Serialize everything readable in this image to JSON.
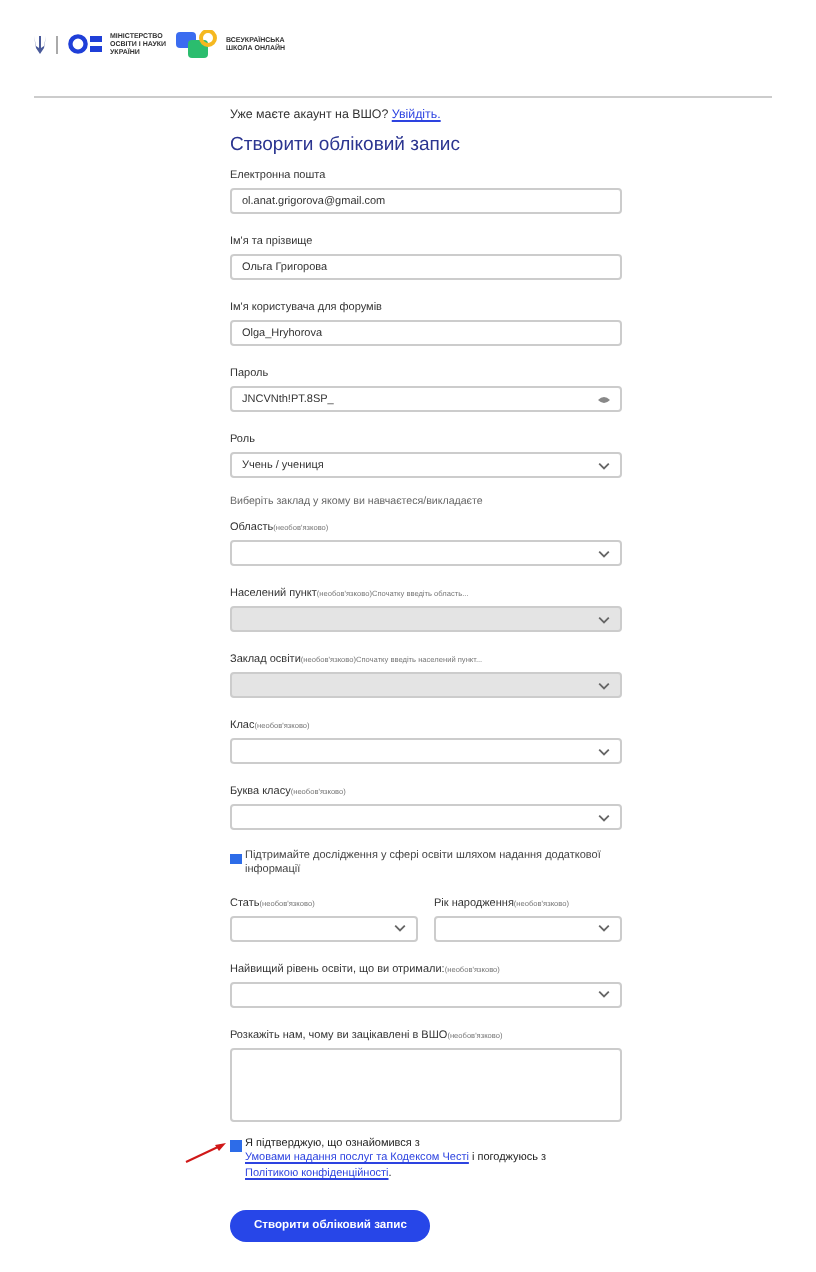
{
  "header": {
    "ministry": "МІНІСТЕРСТВО ОСВІТИ І НАУКИ УКРАЇНИ",
    "school": "ВСЕУКРАЇНСЬКА ШКОЛА ОНЛАЙН"
  },
  "login_prompt": {
    "text": "Уже маєте акаунт на ВШО?",
    "link": "Увійдіть."
  },
  "title": "Створити обліковий запис",
  "fields": [
    {
      "kind": "text",
      "label": "Електронна пошта",
      "value": "ol.anat.grigorova@gmail.com"
    },
    {
      "kind": "text",
      "label": "Ім'я та прізвище",
      "value": "Ольга Григорова"
    },
    {
      "kind": "text",
      "label": "Ім'я користувача для форумів",
      "value": "Olga_Hryhorova"
    },
    {
      "kind": "password",
      "label": "Пароль",
      "value": "JNCVNth!PT.8SP_"
    },
    {
      "kind": "select",
      "label": "Роль",
      "value": "Учень / учениця",
      "disabled": false
    },
    {
      "kind": "note",
      "text": "Виберіть заклад у якому ви навчаєтеся/викладаєте"
    },
    {
      "kind": "select",
      "label": "Область",
      "optional": "(необов'язково)",
      "disabled": false
    },
    {
      "kind": "select",
      "label": "Населений пункт",
      "optional": "(необов'язково)",
      "note": "Спочатку введіть область...",
      "disabled": true
    },
    {
      "kind": "select",
      "label": "Заклад освіти",
      "optional": "(необов'язково)",
      "note": "Спочатку введіть населений пункт...",
      "disabled": true
    },
    {
      "kind": "select",
      "label": "Клас",
      "optional": "(необов'язково)",
      "disabled": false
    },
    {
      "kind": "select",
      "label": "Буква класу",
      "optional": "(необов'язково)",
      "disabled": false
    },
    {
      "kind": "checkbox",
      "text": "Підтримайте дослідження у сфері освіти шляхом надання додаткової інформації",
      "checked": true
    },
    {
      "kind": "pair",
      "children": [
        {
          "kind": "select",
          "label": "Стать",
          "optional": "(необов'язково)",
          "disabled": false
        },
        {
          "kind": "select",
          "label": "Рік народження",
          "optional": "(необов'язково)",
          "disabled": false
        }
      ]
    },
    {
      "kind": "select",
      "label": "Найвищий рівень освіти, що ви отримали:",
      "optional": "(необов'язково)",
      "disabled": false
    },
    {
      "kind": "textarea",
      "label": "Розкажіть нам, чому ви зацікавлені в ВШО",
      "optional": "(необов'язково)"
    }
  ],
  "consent": {
    "checked": true,
    "text_1": "Я підтверджую, що ознайомився з",
    "link_1": "Умовами надання послуг та Кодексом Честі",
    "text_2": "і погоджуюсь з",
    "link_2": "Політикою конфіденційності",
    "text_3": "."
  },
  "submit": "Створити обліковий запис"
}
